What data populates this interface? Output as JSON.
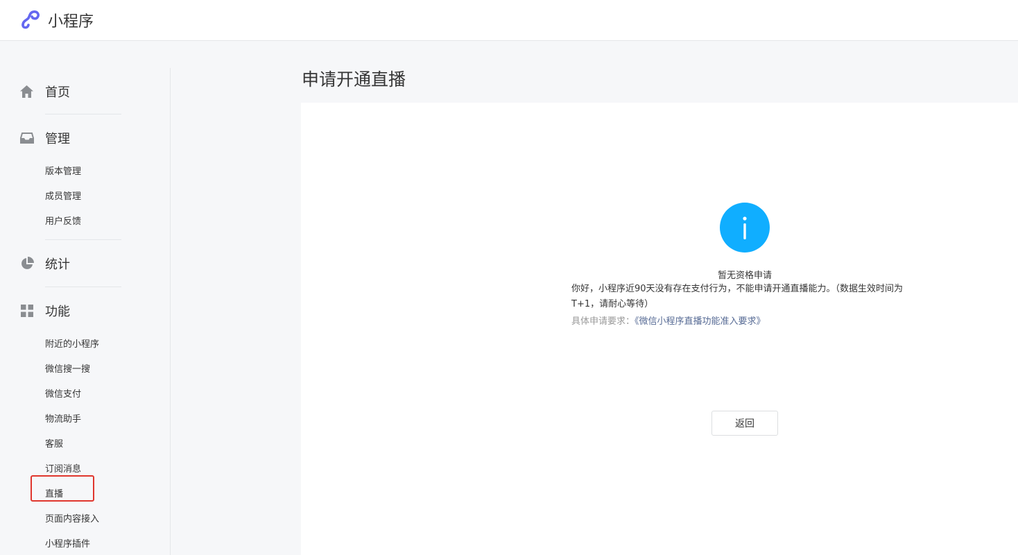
{
  "header": {
    "brand": "小程序"
  },
  "sidebar": {
    "home": {
      "label": "首页"
    },
    "manage": {
      "label": "管理",
      "items": [
        "版本管理",
        "成员管理",
        "用户反馈"
      ]
    },
    "stats": {
      "label": "统计"
    },
    "features": {
      "label": "功能",
      "items": [
        "附近的小程序",
        "微信搜一搜",
        "微信支付",
        "物流助手",
        "客服",
        "订阅消息",
        "直播",
        "页面内容接入",
        "小程序插件"
      ]
    }
  },
  "main": {
    "title": "申请开通直播",
    "notice": {
      "heading": "暂无资格申请",
      "body": "你好，小程序近90天没有存在支付行为，不能申请开通直播能力。（数据生效时间为T+1，请耐心等待）",
      "link_prefix": "具体申请要求：",
      "link_text": "《微信小程序直播功能准入要求》"
    },
    "back_button": "返回"
  },
  "colors": {
    "brand_purple": "#6467f0",
    "info_blue": "#10aeff",
    "link": "#576b95",
    "highlight_red": "#e0362d"
  }
}
